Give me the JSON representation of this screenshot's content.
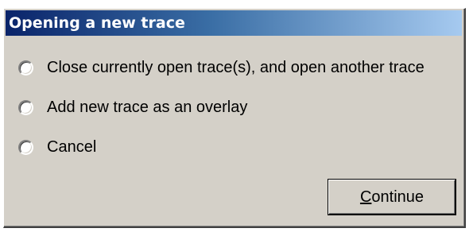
{
  "dialog": {
    "title": "Opening a new trace",
    "options": [
      {
        "label": "Close currently open trace(s), and open another trace",
        "selected": false
      },
      {
        "label": "Add new trace as an overlay",
        "selected": false
      },
      {
        "label": "Cancel",
        "selected": false
      }
    ],
    "continue_button": {
      "mnemonic": "C",
      "rest": "ontinue"
    }
  },
  "colors": {
    "face": "#d4d0c8",
    "title_start": "#0a246a",
    "title_end": "#a6caf0",
    "title_text": "#ffffff"
  }
}
